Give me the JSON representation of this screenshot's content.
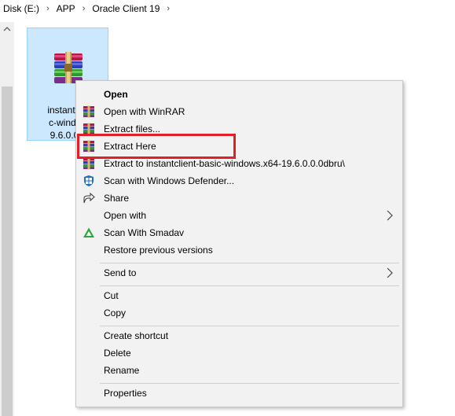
{
  "breadcrumb": {
    "items": [
      "Disk (E:)",
      "APP",
      "Oracle Client 19"
    ],
    "separator": "›"
  },
  "scrollbar": {
    "up_arrow": "^"
  },
  "file": {
    "name": "instantclie\nc-window\n9.6.0.0.0",
    "icon": "winrar-archive-icon",
    "selected_color": "#cce8ff"
  },
  "context_menu": {
    "items": [
      {
        "label": "Open",
        "icon": "",
        "bold": true
      },
      {
        "label": "Open with WinRAR",
        "icon": "winrar-icon"
      },
      {
        "label": "Extract files...",
        "icon": "winrar-icon"
      },
      {
        "label": "Extract Here",
        "icon": "winrar-icon"
      },
      {
        "label": "Extract to instantclient-basic-windows.x64-19.6.0.0.0dbru\\",
        "icon": "winrar-icon"
      },
      {
        "label": "Scan with Windows Defender...",
        "icon": "windows-defender-icon"
      },
      {
        "label": "Share",
        "icon": "share-icon"
      },
      {
        "label": "Open with",
        "icon": "",
        "submenu": true
      },
      {
        "label": "Scan With Smadav",
        "icon": "smadav-icon"
      },
      {
        "label": "Restore previous versions",
        "icon": ""
      },
      {
        "label": "Send to",
        "icon": "",
        "submenu": true
      },
      {
        "label": "Cut",
        "icon": ""
      },
      {
        "label": "Copy",
        "icon": ""
      },
      {
        "label": "Create shortcut",
        "icon": ""
      },
      {
        "label": "Delete",
        "icon": ""
      },
      {
        "label": "Rename",
        "icon": ""
      },
      {
        "label": "Properties",
        "icon": ""
      }
    ]
  },
  "highlight": {
    "target": "Extract Here",
    "color": "#e41e26"
  }
}
